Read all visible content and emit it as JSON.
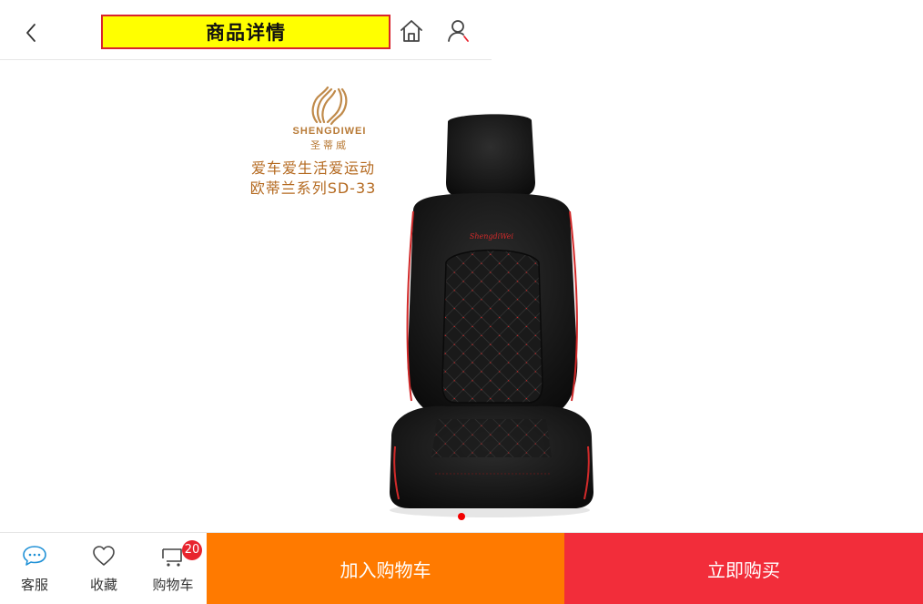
{
  "header": {
    "title": "商品详情",
    "back_icon": "chevron-left-icon",
    "home_icon": "home-icon",
    "user_icon": "user-icon"
  },
  "product": {
    "brand_en": "SHENGDIWEI",
    "brand_cn": "圣蒂威",
    "slogan_line1": "爱车爱生活爱运动",
    "slogan_line2": "欧蒂兰系列SD-33",
    "seat_logo_text": "ShengdiWei"
  },
  "gallery": {
    "current_index": 1,
    "total": 1
  },
  "bottom_bar": {
    "service_label": "客服",
    "favorite_label": "收藏",
    "cart_label": "购物车",
    "cart_count": "20",
    "add_to_cart_label": "加入购物车",
    "buy_now_label": "立即购买"
  },
  "colors": {
    "title_bg": "#ffff00",
    "title_border": "#d9232d",
    "add_cart": "#ff7a00",
    "buy_now": "#f22d3a",
    "brand_gold": "#b87a36",
    "service_icon": "#1e90d6"
  }
}
